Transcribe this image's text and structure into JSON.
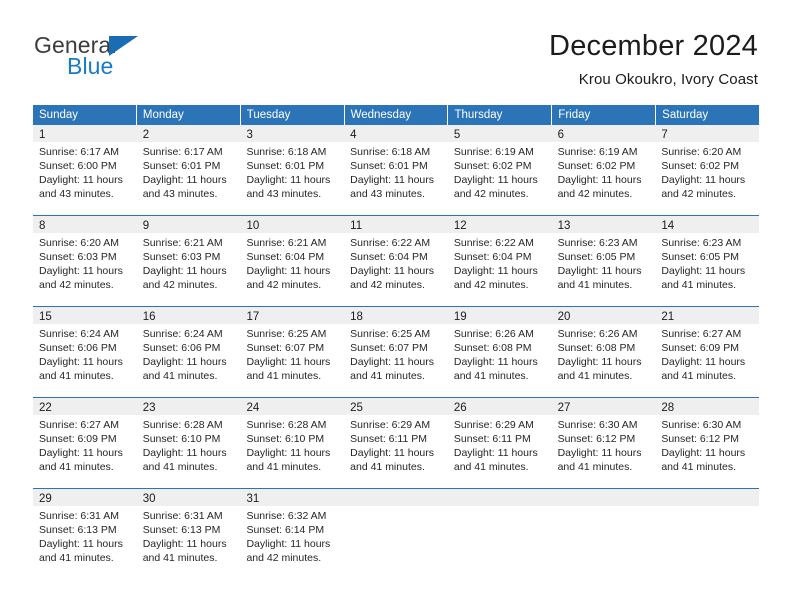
{
  "brand": {
    "name_top": "General",
    "name_bottom": "Blue",
    "triangle_color": "#1a6db5",
    "blue_color": "#1a7ac4"
  },
  "header": {
    "title": "December 2024",
    "subtitle": "Krou Okoukro, Ivory Coast"
  },
  "theme": {
    "header_blue": "#2b74b8",
    "day_band_gray": "#efefef",
    "text": "#1c1c1c"
  },
  "weekdays": [
    "Sunday",
    "Monday",
    "Tuesday",
    "Wednesday",
    "Thursday",
    "Friday",
    "Saturday"
  ],
  "weeks": [
    [
      {
        "day": "1",
        "sunrise": "Sunrise: 6:17 AM",
        "sunset": "Sunset: 6:00 PM",
        "daylight1": "Daylight: 11 hours",
        "daylight2": "and 43 minutes."
      },
      {
        "day": "2",
        "sunrise": "Sunrise: 6:17 AM",
        "sunset": "Sunset: 6:01 PM",
        "daylight1": "Daylight: 11 hours",
        "daylight2": "and 43 minutes."
      },
      {
        "day": "3",
        "sunrise": "Sunrise: 6:18 AM",
        "sunset": "Sunset: 6:01 PM",
        "daylight1": "Daylight: 11 hours",
        "daylight2": "and 43 minutes."
      },
      {
        "day": "4",
        "sunrise": "Sunrise: 6:18 AM",
        "sunset": "Sunset: 6:01 PM",
        "daylight1": "Daylight: 11 hours",
        "daylight2": "and 43 minutes."
      },
      {
        "day": "5",
        "sunrise": "Sunrise: 6:19 AM",
        "sunset": "Sunset: 6:02 PM",
        "daylight1": "Daylight: 11 hours",
        "daylight2": "and 42 minutes."
      },
      {
        "day": "6",
        "sunrise": "Sunrise: 6:19 AM",
        "sunset": "Sunset: 6:02 PM",
        "daylight1": "Daylight: 11 hours",
        "daylight2": "and 42 minutes."
      },
      {
        "day": "7",
        "sunrise": "Sunrise: 6:20 AM",
        "sunset": "Sunset: 6:02 PM",
        "daylight1": "Daylight: 11 hours",
        "daylight2": "and 42 minutes."
      }
    ],
    [
      {
        "day": "8",
        "sunrise": "Sunrise: 6:20 AM",
        "sunset": "Sunset: 6:03 PM",
        "daylight1": "Daylight: 11 hours",
        "daylight2": "and 42 minutes."
      },
      {
        "day": "9",
        "sunrise": "Sunrise: 6:21 AM",
        "sunset": "Sunset: 6:03 PM",
        "daylight1": "Daylight: 11 hours",
        "daylight2": "and 42 minutes."
      },
      {
        "day": "10",
        "sunrise": "Sunrise: 6:21 AM",
        "sunset": "Sunset: 6:04 PM",
        "daylight1": "Daylight: 11 hours",
        "daylight2": "and 42 minutes."
      },
      {
        "day": "11",
        "sunrise": "Sunrise: 6:22 AM",
        "sunset": "Sunset: 6:04 PM",
        "daylight1": "Daylight: 11 hours",
        "daylight2": "and 42 minutes."
      },
      {
        "day": "12",
        "sunrise": "Sunrise: 6:22 AM",
        "sunset": "Sunset: 6:04 PM",
        "daylight1": "Daylight: 11 hours",
        "daylight2": "and 42 minutes."
      },
      {
        "day": "13",
        "sunrise": "Sunrise: 6:23 AM",
        "sunset": "Sunset: 6:05 PM",
        "daylight1": "Daylight: 11 hours",
        "daylight2": "and 41 minutes."
      },
      {
        "day": "14",
        "sunrise": "Sunrise: 6:23 AM",
        "sunset": "Sunset: 6:05 PM",
        "daylight1": "Daylight: 11 hours",
        "daylight2": "and 41 minutes."
      }
    ],
    [
      {
        "day": "15",
        "sunrise": "Sunrise: 6:24 AM",
        "sunset": "Sunset: 6:06 PM",
        "daylight1": "Daylight: 11 hours",
        "daylight2": "and 41 minutes."
      },
      {
        "day": "16",
        "sunrise": "Sunrise: 6:24 AM",
        "sunset": "Sunset: 6:06 PM",
        "daylight1": "Daylight: 11 hours",
        "daylight2": "and 41 minutes."
      },
      {
        "day": "17",
        "sunrise": "Sunrise: 6:25 AM",
        "sunset": "Sunset: 6:07 PM",
        "daylight1": "Daylight: 11 hours",
        "daylight2": "and 41 minutes."
      },
      {
        "day": "18",
        "sunrise": "Sunrise: 6:25 AM",
        "sunset": "Sunset: 6:07 PM",
        "daylight1": "Daylight: 11 hours",
        "daylight2": "and 41 minutes."
      },
      {
        "day": "19",
        "sunrise": "Sunrise: 6:26 AM",
        "sunset": "Sunset: 6:08 PM",
        "daylight1": "Daylight: 11 hours",
        "daylight2": "and 41 minutes."
      },
      {
        "day": "20",
        "sunrise": "Sunrise: 6:26 AM",
        "sunset": "Sunset: 6:08 PM",
        "daylight1": "Daylight: 11 hours",
        "daylight2": "and 41 minutes."
      },
      {
        "day": "21",
        "sunrise": "Sunrise: 6:27 AM",
        "sunset": "Sunset: 6:09 PM",
        "daylight1": "Daylight: 11 hours",
        "daylight2": "and 41 minutes."
      }
    ],
    [
      {
        "day": "22",
        "sunrise": "Sunrise: 6:27 AM",
        "sunset": "Sunset: 6:09 PM",
        "daylight1": "Daylight: 11 hours",
        "daylight2": "and 41 minutes."
      },
      {
        "day": "23",
        "sunrise": "Sunrise: 6:28 AM",
        "sunset": "Sunset: 6:10 PM",
        "daylight1": "Daylight: 11 hours",
        "daylight2": "and 41 minutes."
      },
      {
        "day": "24",
        "sunrise": "Sunrise: 6:28 AM",
        "sunset": "Sunset: 6:10 PM",
        "daylight1": "Daylight: 11 hours",
        "daylight2": "and 41 minutes."
      },
      {
        "day": "25",
        "sunrise": "Sunrise: 6:29 AM",
        "sunset": "Sunset: 6:11 PM",
        "daylight1": "Daylight: 11 hours",
        "daylight2": "and 41 minutes."
      },
      {
        "day": "26",
        "sunrise": "Sunrise: 6:29 AM",
        "sunset": "Sunset: 6:11 PM",
        "daylight1": "Daylight: 11 hours",
        "daylight2": "and 41 minutes."
      },
      {
        "day": "27",
        "sunrise": "Sunrise: 6:30 AM",
        "sunset": "Sunset: 6:12 PM",
        "daylight1": "Daylight: 11 hours",
        "daylight2": "and 41 minutes."
      },
      {
        "day": "28",
        "sunrise": "Sunrise: 6:30 AM",
        "sunset": "Sunset: 6:12 PM",
        "daylight1": "Daylight: 11 hours",
        "daylight2": "and 41 minutes."
      }
    ],
    [
      {
        "day": "29",
        "sunrise": "Sunrise: 6:31 AM",
        "sunset": "Sunset: 6:13 PM",
        "daylight1": "Daylight: 11 hours",
        "daylight2": "and 41 minutes."
      },
      {
        "day": "30",
        "sunrise": "Sunrise: 6:31 AM",
        "sunset": "Sunset: 6:13 PM",
        "daylight1": "Daylight: 11 hours",
        "daylight2": "and 41 minutes."
      },
      {
        "day": "31",
        "sunrise": "Sunrise: 6:32 AM",
        "sunset": "Sunset: 6:14 PM",
        "daylight1": "Daylight: 11 hours",
        "daylight2": "and 42 minutes."
      },
      {
        "day": "",
        "sunrise": "",
        "sunset": "",
        "daylight1": "",
        "daylight2": ""
      },
      {
        "day": "",
        "sunrise": "",
        "sunset": "",
        "daylight1": "",
        "daylight2": ""
      },
      {
        "day": "",
        "sunrise": "",
        "sunset": "",
        "daylight1": "",
        "daylight2": ""
      },
      {
        "day": "",
        "sunrise": "",
        "sunset": "",
        "daylight1": "",
        "daylight2": ""
      }
    ]
  ]
}
